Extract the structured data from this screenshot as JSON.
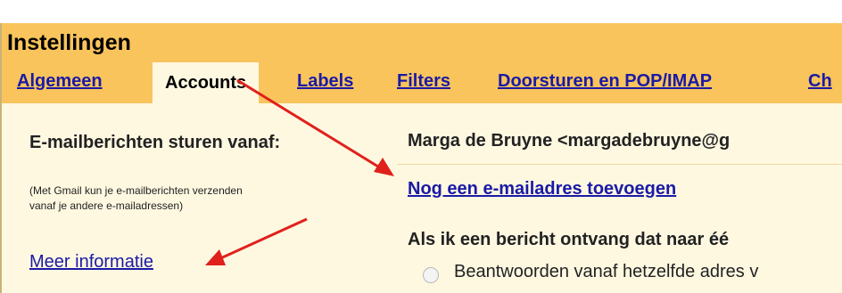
{
  "page": {
    "title": "Instellingen"
  },
  "tabs": [
    {
      "label": "Algemeen",
      "active": false
    },
    {
      "label": "Accounts",
      "active": true
    },
    {
      "label": "Labels",
      "active": false
    },
    {
      "label": "Filters",
      "active": false
    },
    {
      "label": "Doorsturen en POP/IMAP",
      "active": false
    },
    {
      "label": "Ch",
      "active": false
    }
  ],
  "left_panel": {
    "heading": "E-mailberichten sturen vanaf:",
    "note": "(Met Gmail kun je e-mailberichten verzenden vanaf je andere e-mailadressen)",
    "more_link": "Meer informatie"
  },
  "right_panel": {
    "account": "Marga de Bruyne <margadebruyne@g",
    "add_link": "Nog een e-mailadres toevoegen",
    "question": "Als ik een bericht ontvang dat naar éé",
    "radio_label": "Beantwoorden vanaf hetzelfde adres v"
  },
  "colors": {
    "header": "#f9c45b",
    "panel": "#fff8e1",
    "link": "#1a1aa6",
    "arrow": "#e0201b"
  }
}
